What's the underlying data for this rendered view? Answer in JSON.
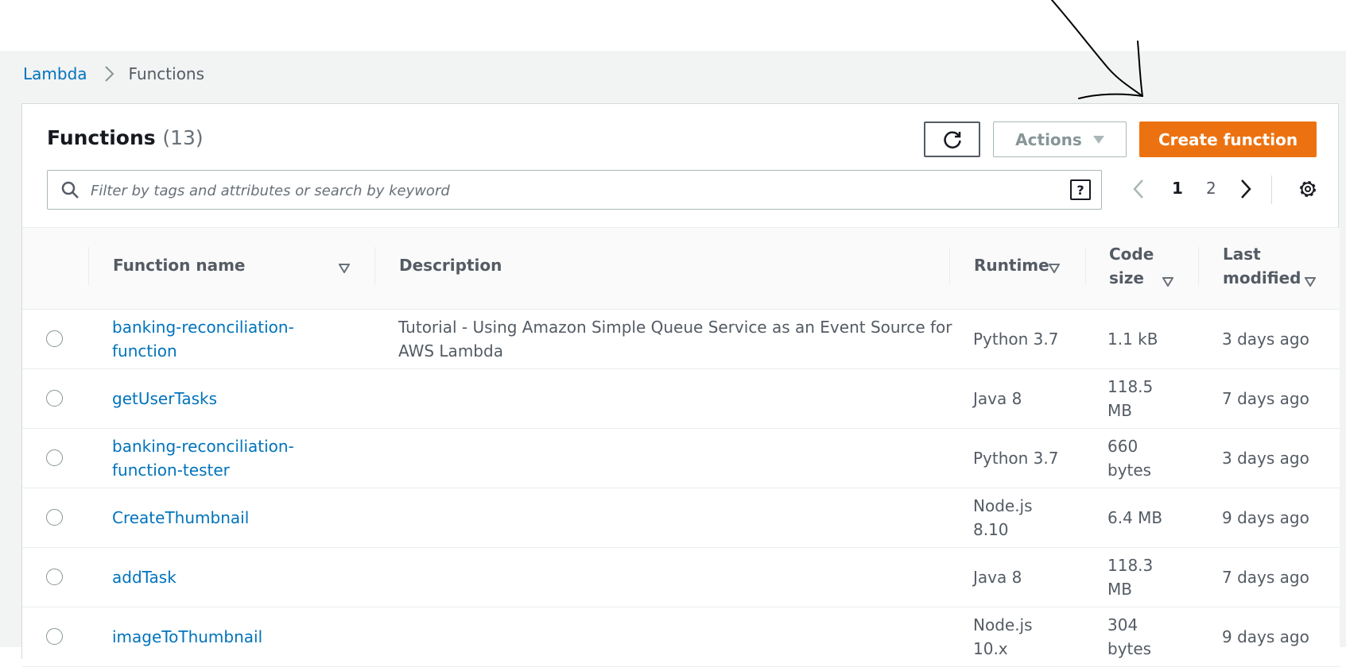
{
  "breadcrumb": {
    "root": "Lambda",
    "current": "Functions"
  },
  "functions_panel": {
    "title": "Functions",
    "count": "(13)",
    "actions_label": "Actions",
    "create_label": "Create function",
    "search_placeholder": "Filter by tags and attributes or search by keyword",
    "help_label": "?",
    "pagination": {
      "page_1": "1",
      "page_2": "2"
    }
  },
  "table": {
    "columns": {
      "name": "Function name",
      "description": "Description",
      "runtime": "Runtime",
      "code_size_line1": "Code",
      "code_size_line2": "size",
      "modified_line1": "Last",
      "modified_line2": "modified"
    },
    "rows": [
      {
        "name_line1": "banking-reconciliation-",
        "name_line2": "function",
        "desc_line1": "Tutorial - Using Amazon Simple Queue Service as an Event Source for",
        "desc_line2": "AWS Lambda",
        "runtime_line1": "Python 3.7",
        "runtime_line2": "",
        "size_line1": "1.1 kB",
        "size_line2": "",
        "modified": "3 days ago"
      },
      {
        "name_line1": "getUserTasks",
        "name_line2": "",
        "desc_line1": "",
        "desc_line2": "",
        "runtime_line1": "Java 8",
        "runtime_line2": "",
        "size_line1": "118.5",
        "size_line2": "MB",
        "modified": "7 days ago"
      },
      {
        "name_line1": "banking-reconciliation-",
        "name_line2": "function-tester",
        "desc_line1": "",
        "desc_line2": "",
        "runtime_line1": "Python 3.7",
        "runtime_line2": "",
        "size_line1": "660",
        "size_line2": "bytes",
        "modified": "3 days ago"
      },
      {
        "name_line1": "CreateThumbnail",
        "name_line2": "",
        "desc_line1": "",
        "desc_line2": "",
        "runtime_line1": "Node.js",
        "runtime_line2": "8.10",
        "size_line1": "6.4 MB",
        "size_line2": "",
        "modified": "9 days ago"
      },
      {
        "name_line1": "addTask",
        "name_line2": "",
        "desc_line1": "",
        "desc_line2": "",
        "runtime_line1": "Java 8",
        "runtime_line2": "",
        "size_line1": "118.3",
        "size_line2": "MB",
        "modified": "7 days ago"
      },
      {
        "name_line1": "imageToThumbnail",
        "name_line2": "",
        "desc_line1": "",
        "desc_line2": "",
        "runtime_line1": "Node.js",
        "runtime_line2": "10.x",
        "size_line1": "304",
        "size_line2": "bytes",
        "modified": "9 days ago"
      }
    ]
  },
  "colors": {
    "link": "#0073bb",
    "primary_button": "#ec7211",
    "console_background": "#f2f3f3"
  },
  "icons": [
    "chevron-right-icon",
    "refresh-icon",
    "caret-down-icon",
    "search-icon",
    "help-icon",
    "chevron-left-icon",
    "settings-gear-icon",
    "sort-icon",
    "annotation-arrow"
  ]
}
